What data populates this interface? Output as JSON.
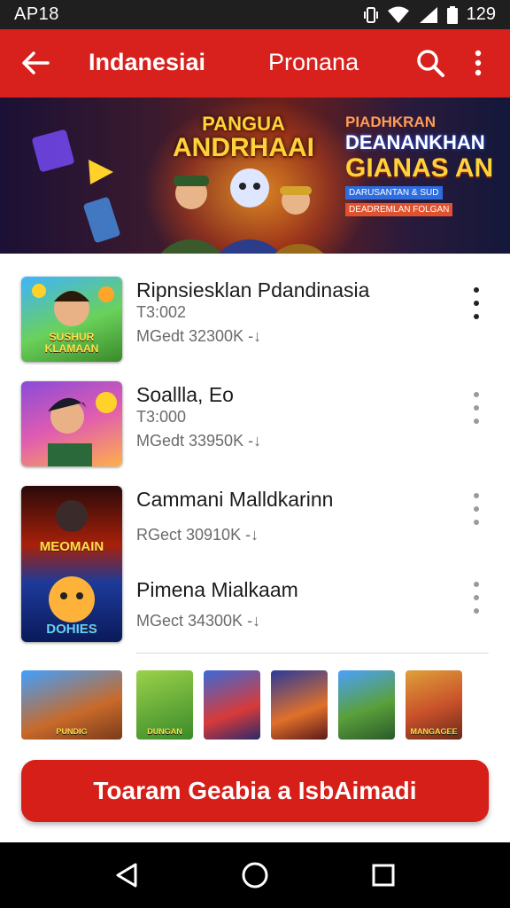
{
  "status_bar": {
    "time": "AP18",
    "battery": "129",
    "icons": [
      "vibrate-icon",
      "wifi-icon",
      "signal-icon",
      "battery-icon"
    ]
  },
  "app_bar": {
    "title": "Indanesiai",
    "tab": "Pronana",
    "icons": [
      "back-arrow-icon",
      "search-icon",
      "more-vert-icon"
    ]
  },
  "banner": {
    "title_line1": "PANGUA",
    "title_line2": "ANDRHAAI",
    "sub1": "PIADHKRAN",
    "sub2": "DEANANKHAN",
    "sub3": "GIANAS AN",
    "tag1": "DARUSANTAN & SUD",
    "tag2": "DEADREMLAN FOLGAN"
  },
  "games": [
    {
      "title": "Ripnsiesklan Pdandinasia",
      "meta1": "T3:002",
      "meta2": "MGedt 32300K -↓",
      "thumb_caption": "SUSHUR KLAMAAN"
    },
    {
      "title": "Soallla, Eo",
      "meta1": "T3:000",
      "meta2": "MGedt 33950K -↓",
      "thumb_caption": ""
    },
    {
      "title": "Cammani Malldkarinn",
      "meta1": "",
      "meta2": "RGect 30910K -↓",
      "thumb_caption": "MEOMAIN"
    },
    {
      "title": "Pimena Mialkaam",
      "meta1": "",
      "meta2": "MGect 34300K -↓",
      "thumb_caption": "DOHIES"
    }
  ],
  "mini_thumbs": [
    {
      "caption": "PUNDIG"
    },
    {
      "caption": "DUNGAN"
    },
    {
      "caption": ""
    },
    {
      "caption": ""
    },
    {
      "caption": ""
    },
    {
      "caption": "MANGAGEE"
    }
  ],
  "cta": {
    "label": "Toaram Geabia a IsbAimadi"
  },
  "nav": {
    "icons": [
      "back-triangle-icon",
      "home-circle-icon",
      "recents-square-icon"
    ]
  },
  "colors": {
    "primary_red": "#d8201c",
    "status_bar": "#1f1f1f",
    "nav_bar": "#000000"
  }
}
